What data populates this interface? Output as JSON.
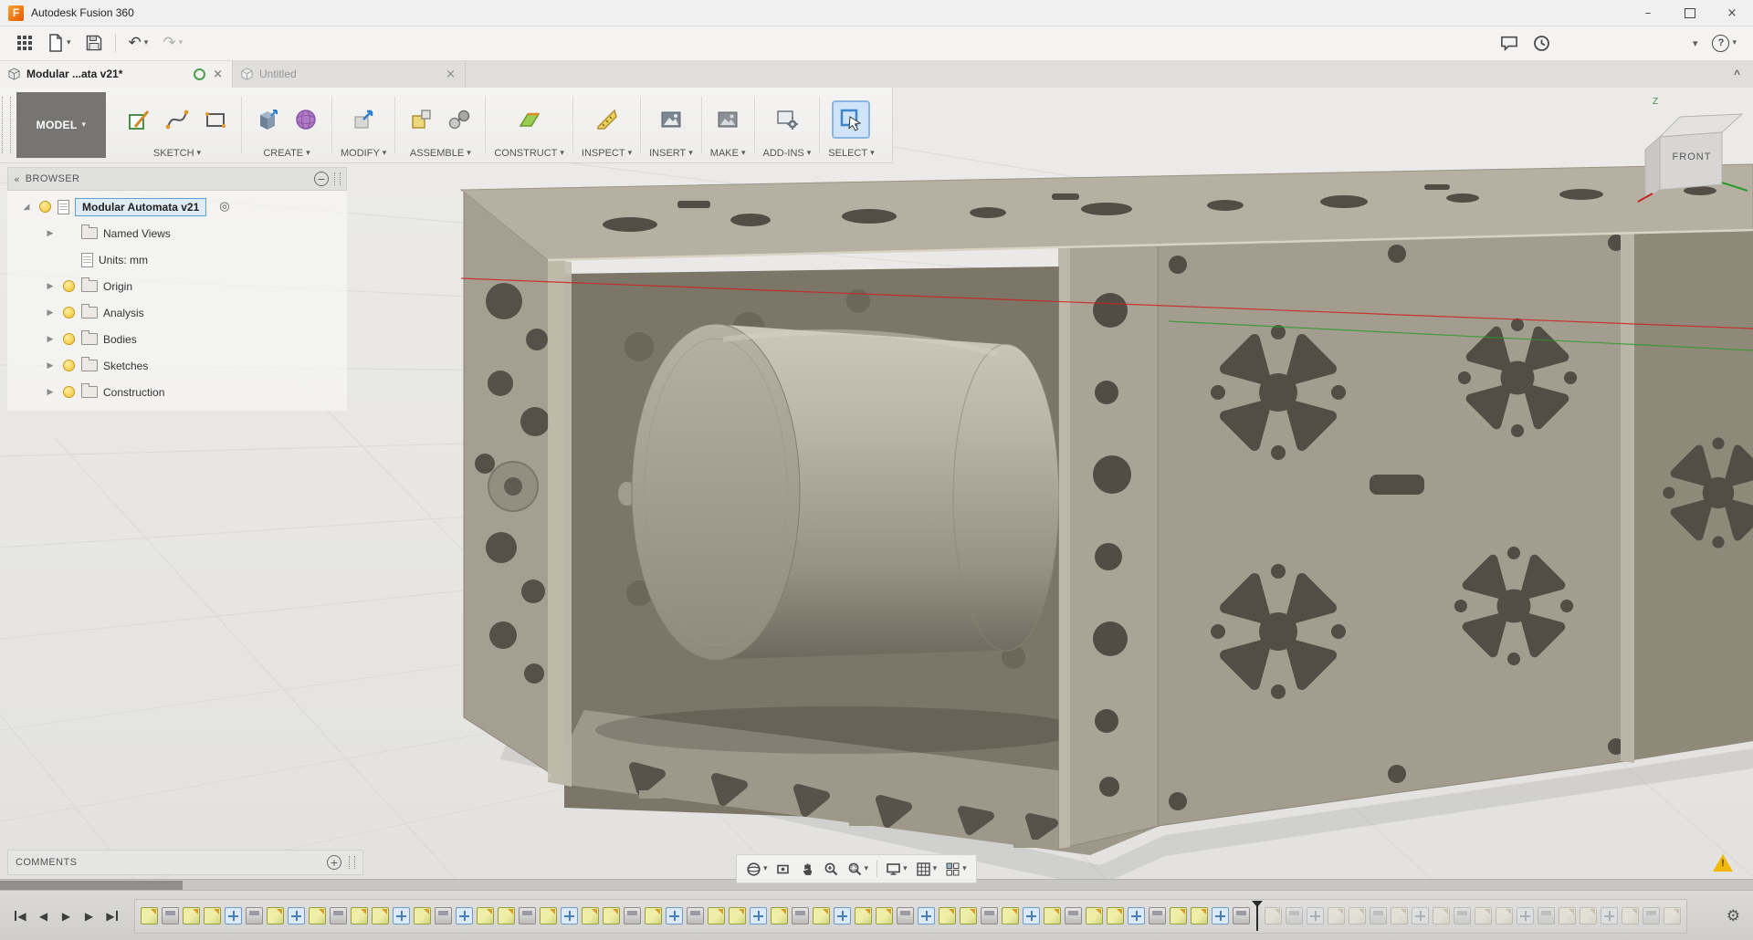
{
  "window": {
    "logo_letter": "F",
    "title": "Autodesk Fusion 360"
  },
  "icons": {
    "caret_down": "▾",
    "close": "×",
    "chevron_up": "^",
    "minimize": "–",
    "undo": "↶",
    "redo": "↷",
    "help": "?",
    "expand_arrow": "▶",
    "root_corner": "◢",
    "collapse_panel": "«",
    "minus_badge": "−",
    "plus_badge": "+",
    "target": "◎",
    "gear": "⚙",
    "warning_mark": "!",
    "play": "▶",
    "back": "◀"
  },
  "tabs": {
    "items": [
      {
        "label": "Modular ...ata v21*"
      },
      {
        "label": "Untitled"
      }
    ]
  },
  "ribbon": {
    "workspace": "MODEL",
    "groups": [
      {
        "label": "SKETCH"
      },
      {
        "label": "CREATE"
      },
      {
        "label": "MODIFY"
      },
      {
        "label": "ASSEMBLE"
      },
      {
        "label": "CONSTRUCT"
      },
      {
        "label": "INSPECT"
      },
      {
        "label": "INSERT"
      },
      {
        "label": "MAKE"
      },
      {
        "label": "ADD-INS"
      },
      {
        "label": "SELECT"
      }
    ]
  },
  "browser": {
    "header": "BROWSER",
    "root_label": "Modular Automata v21",
    "items": [
      {
        "label": "Named Views",
        "arrow": true,
        "bulb": false,
        "icon": "folder"
      },
      {
        "label": "Units: mm",
        "arrow": false,
        "bulb": false,
        "icon": "page"
      },
      {
        "label": "Origin",
        "arrow": true,
        "bulb": true,
        "icon": "folder"
      },
      {
        "label": "Analysis",
        "arrow": true,
        "bulb": true,
        "icon": "folder"
      },
      {
        "label": "Bodies",
        "arrow": true,
        "bulb": true,
        "icon": "folder"
      },
      {
        "label": "Sketches",
        "arrow": true,
        "bulb": true,
        "icon": "folder"
      },
      {
        "label": "Construction",
        "arrow": true,
        "bulb": true,
        "icon": "folder"
      }
    ]
  },
  "viewcube": {
    "front": "FRONT",
    "z": "Z"
  },
  "comments": {
    "header": "COMMENTS"
  },
  "timeline": {
    "marker_after": 53,
    "features": [
      "s",
      "e",
      "s",
      "s",
      "m",
      "e",
      "s",
      "m",
      "s",
      "e",
      "s",
      "s",
      "m",
      "s",
      "e",
      "m",
      "s",
      "s",
      "e",
      "s",
      "m",
      "s",
      "s",
      "e",
      "s",
      "m",
      "e",
      "s",
      "s",
      "m",
      "s",
      "e",
      "s",
      "m",
      "s",
      "s",
      "e",
      "m",
      "s",
      "s",
      "e",
      "s",
      "m",
      "s",
      "e",
      "s",
      "s",
      "m",
      "e",
      "s",
      "s",
      "m",
      "e",
      "s",
      "e",
      "m",
      "s",
      "s",
      "e",
      "s",
      "m",
      "s",
      "e",
      "s",
      "s",
      "m",
      "e",
      "s",
      "s",
      "m",
      "s",
      "e",
      "s"
    ]
  },
  "colors": {
    "selection_blue": "#5f9fd8",
    "select_tool_bg": "#cfe4f8",
    "model_tan": "#a9a495",
    "warning_yellow": "#f2b705",
    "axis_red": "#cc2222",
    "axis_green": "#2a9a2a"
  }
}
